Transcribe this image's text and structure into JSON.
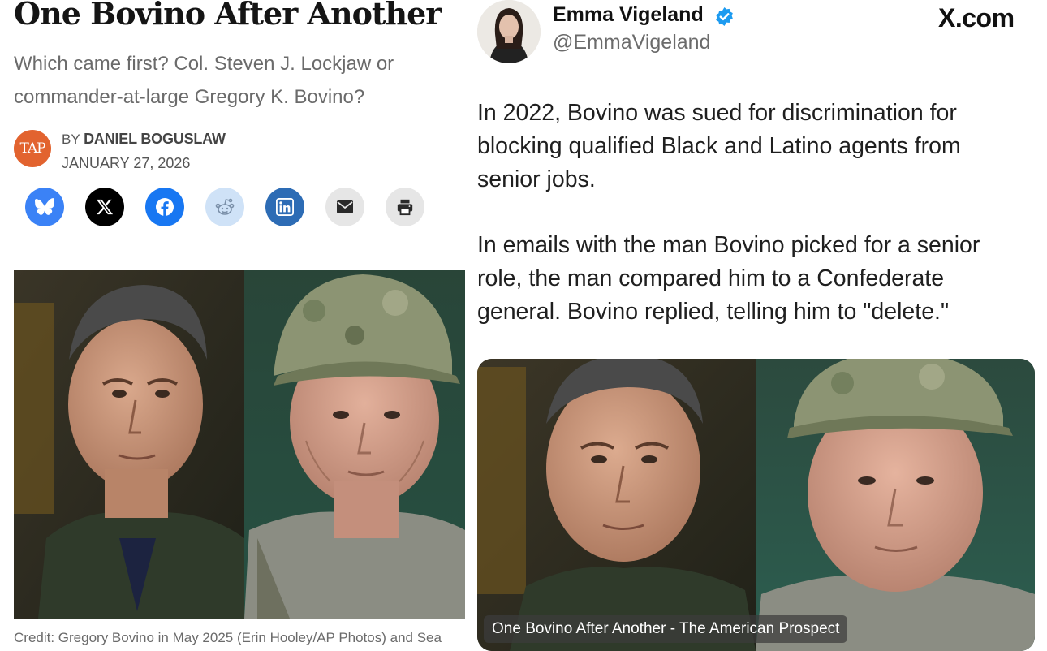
{
  "article": {
    "title": "One Bovino After Another",
    "subtitle": "Which came first? Col. Steven J. Lockjaw or commander-at-large Gregory K. Bovino?",
    "logo_text": "TAP",
    "byline_prefix": "BY ",
    "author": "DANIEL BOGUSLAW",
    "date": "JANUARY 27, 2026",
    "share_buttons": [
      {
        "icon": "bluesky-icon",
        "color": "#3b82f6"
      },
      {
        "icon": "x-icon",
        "color": "#000000"
      },
      {
        "icon": "facebook-icon",
        "color": "#1877f2"
      },
      {
        "icon": "reddit-icon",
        "color": "#cfe2f7"
      },
      {
        "icon": "linkedin-icon",
        "color": "#2d6cb5"
      },
      {
        "icon": "email-icon",
        "color": "#e6e6e6"
      },
      {
        "icon": "print-icon",
        "color": "#e6e6e6"
      }
    ],
    "image_credit": "Credit: Gregory Bovino in May 2025 (Erin Hooley/AP Photos) and Sea"
  },
  "tweet": {
    "display_name": "Emma Vigeland",
    "verified": true,
    "handle": "@EmmaVigeland",
    "site_label": "X.com",
    "paragraphs": [
      "In 2022, Bovino was sued for discrimination for blocking qualified Black and Latino agents from senior jobs.",
      "In emails with the man Bovino picked for a senior role, the man compared him to a Confederate general. Bovino replied, telling him to \"delete.\""
    ],
    "card_caption": "One Bovino After Another - The American Prospect"
  },
  "colors": {
    "tap_orange": "#e2632f",
    "verified_blue": "#1d9bf0",
    "muted_text": "#6b6b6b"
  }
}
